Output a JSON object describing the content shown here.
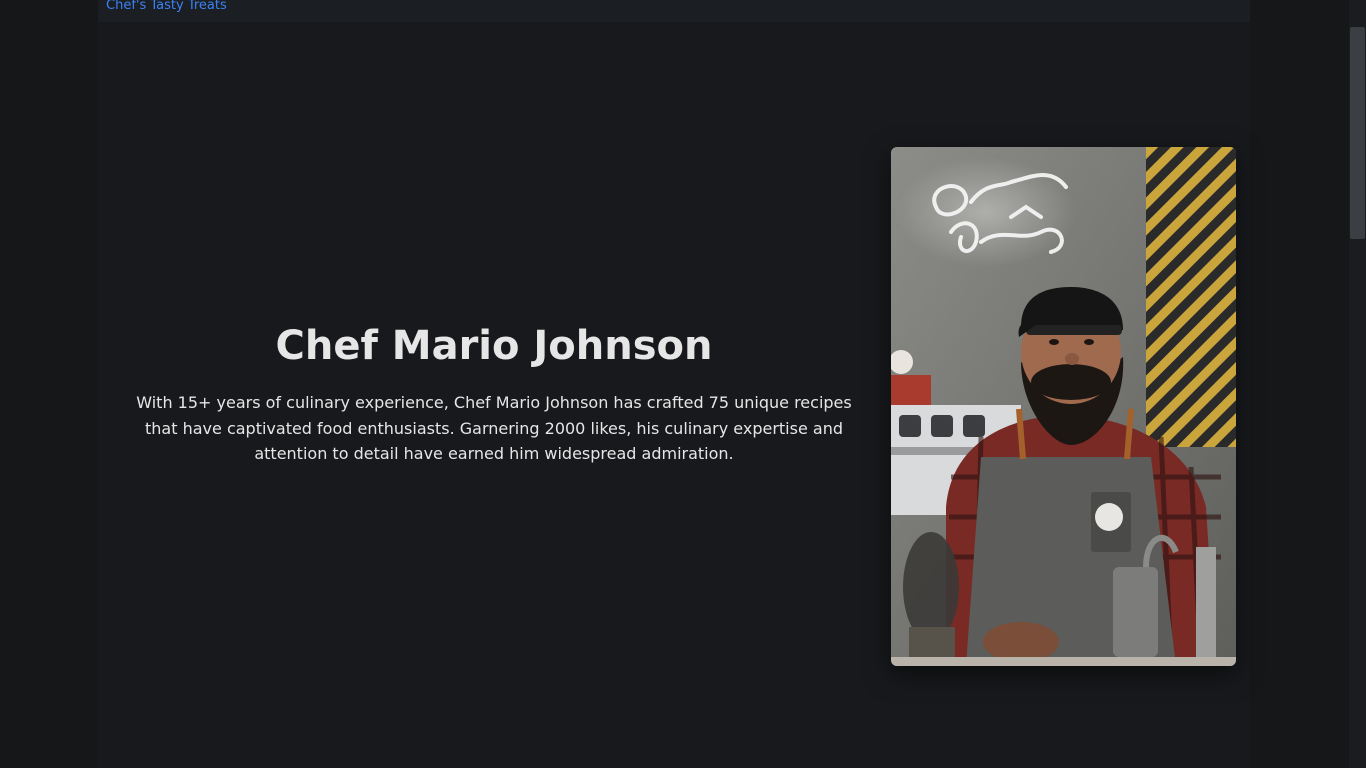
{
  "header": {
    "brand_link": "Chef's Tasty Treats"
  },
  "hero": {
    "chef_name": "Chef Mario Johnson",
    "bio": "With 15+ years of culinary experience, Chef Mario Johnson has crafted 75 unique recipes that have captivated food enthusiasts. Garnering 2000 likes, his culinary expertise and attention to detail have earned him widespread admiration.",
    "photo_icon": "chef-portrait-image",
    "neon_sign": "Origin Coffee Lab"
  },
  "colors": {
    "accent": "#3b82f6",
    "background": "#151719",
    "text": "#e6e6e6"
  }
}
